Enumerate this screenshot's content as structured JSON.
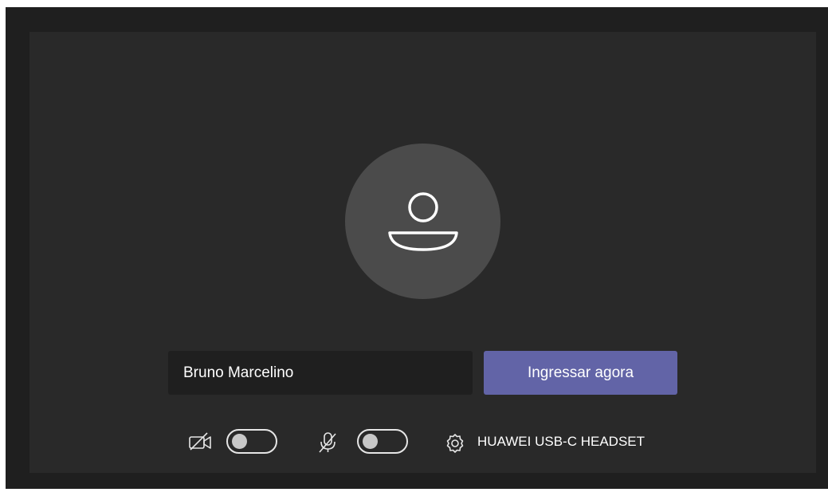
{
  "prejoin": {
    "name_input": {
      "value": "Bruno Marcelino"
    },
    "join_button_label": "Ingressar agora",
    "camera": {
      "state": "off",
      "icon": "video-off-icon"
    },
    "microphone": {
      "state": "off",
      "icon": "mic-off-icon"
    },
    "device": {
      "icon": "gear-icon",
      "label": "HUAWEI USB-C HEADSET"
    },
    "avatar_icon": "person-icon"
  },
  "colors": {
    "frame": "#1f1f1f",
    "panel": "#292929",
    "avatar_bg": "#4b4b4b",
    "input_bg": "#1f1f1f",
    "accent": "#6264a7",
    "text": "#ffffff"
  }
}
